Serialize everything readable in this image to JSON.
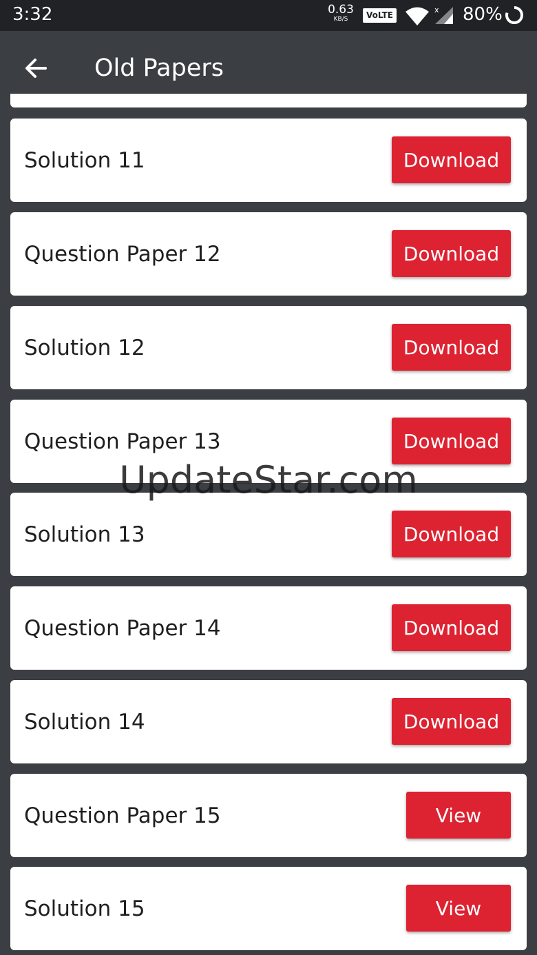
{
  "status_bar": {
    "time": "3:32",
    "net_speed_value": "0.63",
    "net_speed_unit": "KB/S",
    "network_badge": "VoLTE",
    "battery": "80%",
    "icons": [
      "wifi-icon",
      "signal-icon",
      "battery-icon"
    ]
  },
  "app_bar": {
    "back_icon": "arrow-left-icon",
    "title": "Old Papers"
  },
  "items": [
    {
      "title": "Solution 11",
      "button": "Download"
    },
    {
      "title": "Question Paper 12",
      "button": "Download"
    },
    {
      "title": "Solution 12",
      "button": "Download"
    },
    {
      "title": "Question Paper 13",
      "button": "Download"
    },
    {
      "title": "Solution 13",
      "button": "Download"
    },
    {
      "title": "Question Paper 14",
      "button": "Download"
    },
    {
      "title": "Solution 14",
      "button": "Download"
    },
    {
      "title": "Question Paper 15",
      "button": "View"
    },
    {
      "title": "Solution 15",
      "button": "View"
    }
  ],
  "watermark": "UpdateStar.com",
  "colors": {
    "background": "#3b3e42",
    "status_bar": "#202225",
    "button": "#dd2231",
    "card": "#ffffff"
  }
}
